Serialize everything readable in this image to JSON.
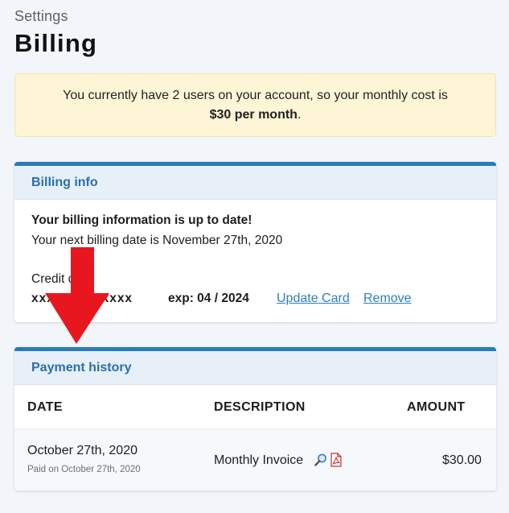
{
  "breadcrumb": "Settings",
  "title": "Billing",
  "notice": {
    "text_before": "You currently have 2 users on your account, so your monthly cost is",
    "cost": "$30 per month",
    "text_after": "."
  },
  "billing_info": {
    "header": "Billing info",
    "status": "Your billing information is up to date!",
    "next_billing": "Your next billing date is November 27th, 2020",
    "card_label": "Credit card",
    "card_number": "xxxx xxxx xxxx",
    "expiry": "exp: 04 / 2024",
    "update_link": "Update Card",
    "remove_link": "Remove"
  },
  "payment_history": {
    "header": "Payment history",
    "columns": [
      "DATE",
      "DESCRIPTION",
      "AMOUNT"
    ],
    "rows": [
      {
        "date": "October 27th, 2020",
        "paid": "Paid on October 27th, 2020",
        "description": "Monthly Invoice",
        "icons": [
          "magnifier-icon",
          "pdf-icon"
        ],
        "amount": "$30.00"
      }
    ]
  },
  "colors": {
    "accent": "#2a7bb6",
    "link": "#2f7fb7",
    "notice_bg": "#fdf5d6",
    "arrow": "#e8161f"
  }
}
